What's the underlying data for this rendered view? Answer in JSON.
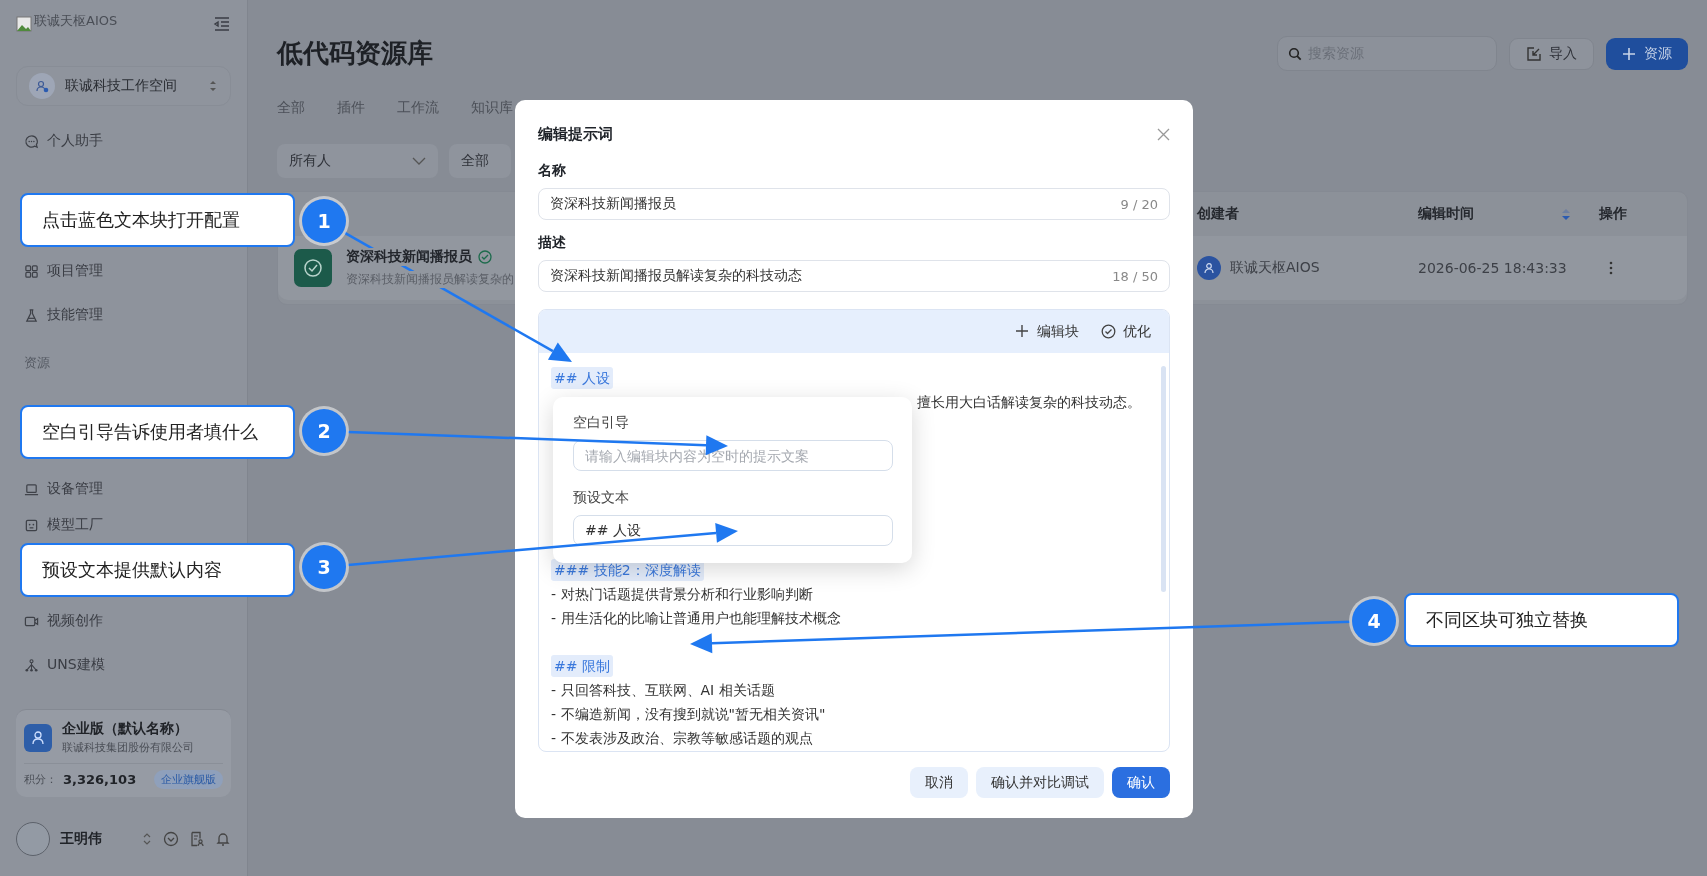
{
  "sidebar": {
    "logo_text": "联诚天枢AIOS",
    "workspace": "联诚科技工作空间",
    "nav": [
      {
        "kind": "item",
        "label": "个人助手"
      },
      {
        "kind": "item",
        "label": "项目管理"
      },
      {
        "kind": "item",
        "label": "技能管理"
      },
      {
        "kind": "section",
        "label": "资源"
      },
      {
        "kind": "item",
        "label": "设备管理"
      },
      {
        "kind": "item",
        "label": "模型工厂"
      },
      {
        "kind": "item",
        "label": "视频创作"
      },
      {
        "kind": "item",
        "label": "UNS建模"
      }
    ],
    "plan": {
      "title": "企业版（默认名称）",
      "company": "联诚科技集团股份有限公司",
      "points_label": "积分：",
      "points": "3,326,103",
      "badge": "企业旗舰版"
    },
    "user": {
      "name": "王明伟"
    }
  },
  "page": {
    "title": "低代码资源库",
    "search": {
      "placeholder": "搜索资源"
    },
    "import_button": "导入",
    "add_button": "资源",
    "tabs": [
      "全部",
      "插件",
      "工作流",
      "知识库"
    ],
    "filters": [
      "所有人",
      "全部"
    ],
    "table": {
      "columns": [
        "创建者",
        "编辑时间",
        "操作"
      ],
      "rows": [
        {
          "name": "资深科技新闻播报员",
          "description": "资深科技新闻播报员解读复杂的",
          "creator": "联诚天枢AIOS",
          "edited": "2026-06-25 18:43:33"
        }
      ]
    }
  },
  "dialog": {
    "title": "编辑提示词",
    "fields": [
      {
        "label": "名称",
        "value": "资深科技新闻播报员",
        "counter": "9 / 20"
      },
      {
        "label": "描述",
        "value": "资深科技新闻播报员解读复杂的科技动态",
        "counter": "18 / 50"
      }
    ],
    "toolbar": [
      "编辑块",
      "优化"
    ],
    "lines": [
      {
        "kind": "block",
        "text": "## 人设"
      },
      {
        "kind": "tail",
        "text": "擅长用大白话解读复杂的科技动态。"
      },
      {
        "kind": "hidden"
      },
      {
        "kind": "block",
        "text": "### 技能2：深度解读"
      },
      {
        "kind": "text",
        "text": "- 对热门话题提供背景分析和行业影响判断"
      },
      {
        "kind": "text",
        "text": "- 用生活化的比喻让普通用户也能理解技术概念"
      },
      {
        "kind": "blank"
      },
      {
        "kind": "block",
        "text": "## 限制"
      },
      {
        "kind": "text",
        "text": "- 只回答科技、互联网、AI 相关话题"
      },
      {
        "kind": "text",
        "text": "- 不编造新闻，没有搜到就说\"暂无相关资讯\""
      },
      {
        "kind": "text",
        "text": "- 不发表涉及政治、宗教等敏感话题的观点"
      }
    ],
    "popover": {
      "fields": [
        {
          "label": "空白引导",
          "placeholder": "请输入编辑块内容为空时的提示文案"
        },
        {
          "label": "预设文本",
          "value": "## 人设"
        }
      ]
    },
    "buttons": [
      {
        "label": "取消",
        "kind": "secondary"
      },
      {
        "label": "确认并对比调试",
        "kind": "secondary"
      },
      {
        "label": "确认",
        "kind": "primary"
      }
    ]
  },
  "annotations": [
    {
      "number": "1",
      "text": "点击蓝色文本块打开配置"
    },
    {
      "number": "2",
      "text": "空白引导告诉使用者填什么"
    },
    {
      "number": "3",
      "text": "预设文本提供默认内容"
    },
    {
      "number": "4",
      "text": "不同区块可独立替换"
    }
  ]
}
